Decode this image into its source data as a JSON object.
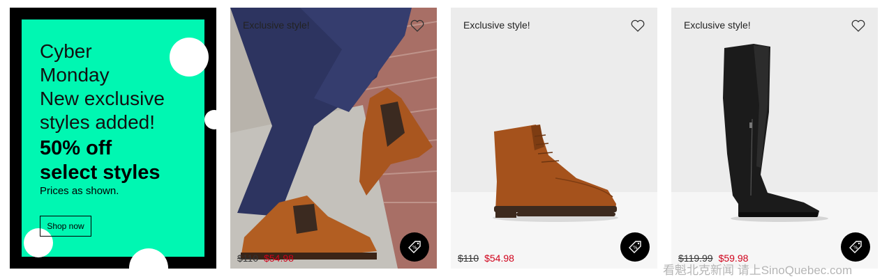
{
  "promo": {
    "headline": [
      "Cyber",
      "Monday",
      "New exclusive",
      "styles added!"
    ],
    "offer": [
      "50% off",
      "select styles"
    ],
    "note": "Prices as shown.",
    "button_label": "Shop now",
    "background_color": "#00f7b2"
  },
  "products": [
    {
      "badge": "Exclusive style!",
      "price_old": "$110",
      "price_new": "$54.98",
      "image": "lifestyle-chelsea-boot-photo",
      "icons": [
        "heart-icon",
        "discount-tag-icon"
      ]
    },
    {
      "badge": "Exclusive style!",
      "price_old": "$110",
      "price_new": "$54.98",
      "image": "cognac-lace-up-ankle-boot-photo",
      "icons": [
        "heart-icon",
        "discount-tag-icon"
      ]
    },
    {
      "badge": "Exclusive style!",
      "price_old": "$119.99",
      "price_new": "$59.98",
      "image": "black-over-the-knee-boot-photo",
      "icons": [
        "heart-icon",
        "discount-tag-icon"
      ]
    }
  ],
  "colors": {
    "sale_price": "#d0021b",
    "accent_mint": "#00f7b2"
  },
  "watermark": "看魁北克新闻 请上SinoQuebec.com"
}
